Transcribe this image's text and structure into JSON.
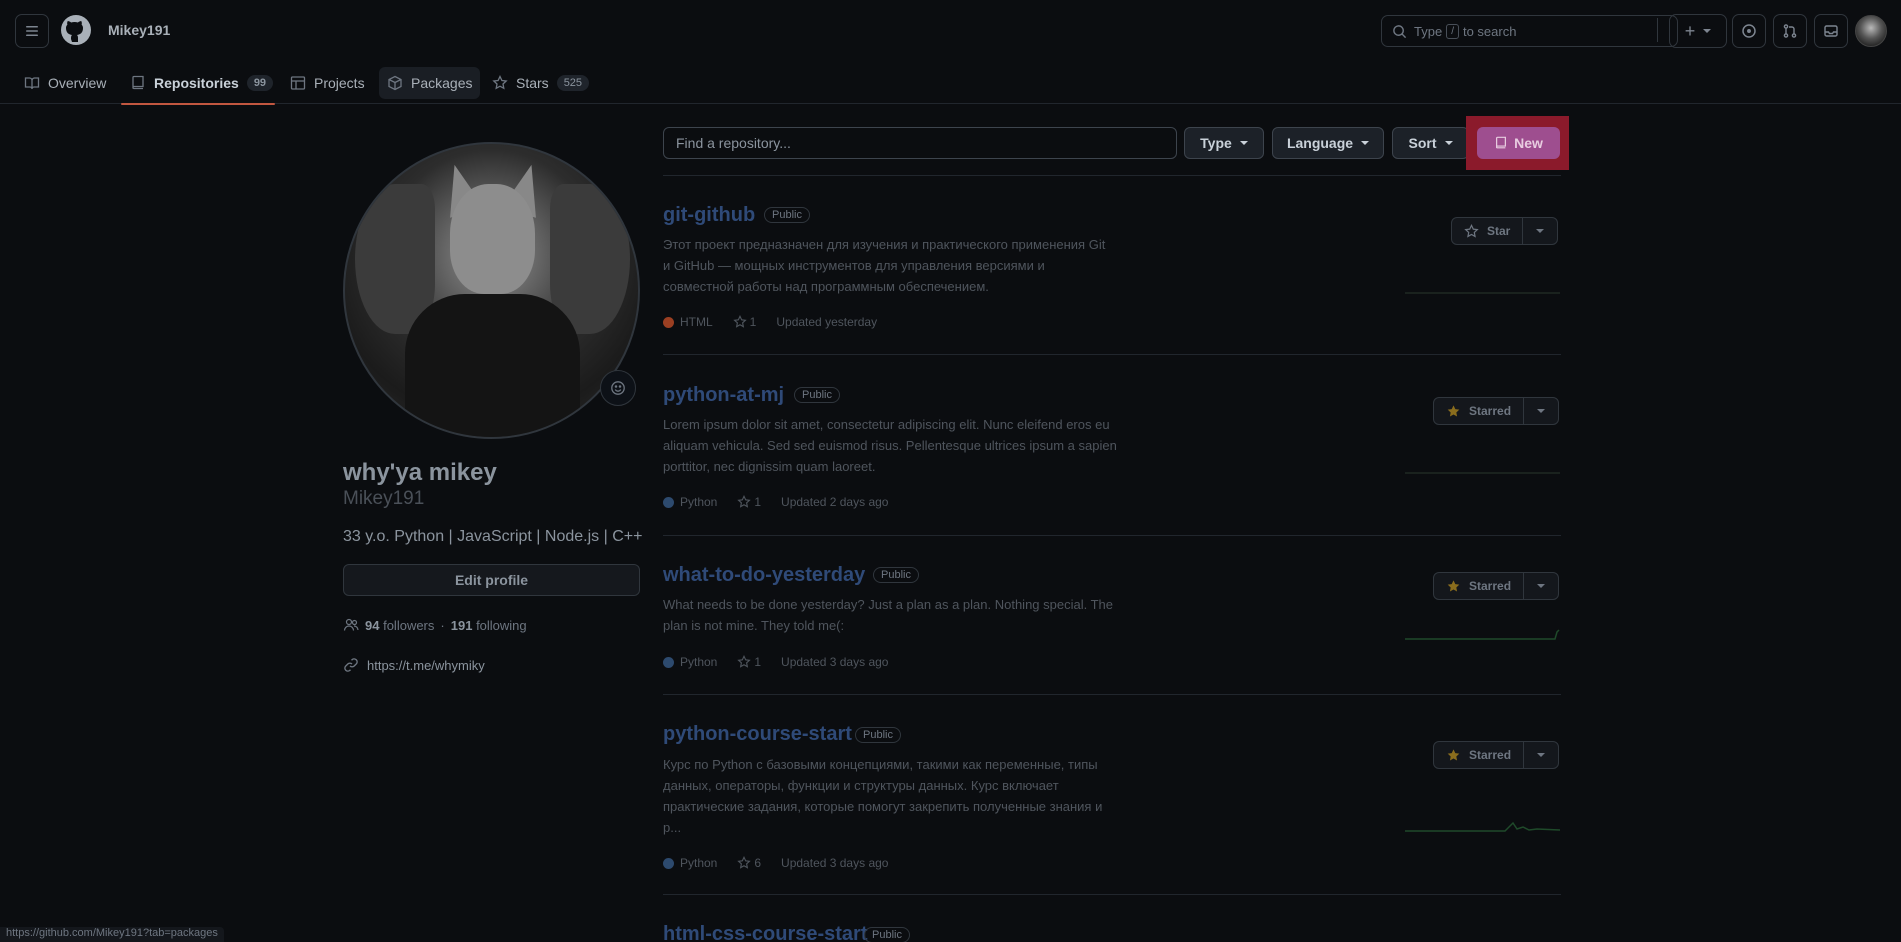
{
  "header": {
    "username": "Mikey191",
    "search_placeholder_before": "Type",
    "search_key": "/",
    "search_placeholder_after": "to search",
    "plus_label": "+"
  },
  "tabs": [
    {
      "label": "Overview",
      "icon": "book-icon"
    },
    {
      "label": "Repositories",
      "count": "99",
      "icon": "repo-icon"
    },
    {
      "label": "Projects",
      "icon": "table-icon"
    },
    {
      "label": "Packages",
      "icon": "package-icon"
    },
    {
      "label": "Stars",
      "count": "525",
      "icon": "star-icon"
    }
  ],
  "profile": {
    "full_name": "why'ya mikey",
    "login": "Mikey191",
    "bio": "33 y.o. Python | JavaScript | Node.js | C++",
    "edit_label": "Edit profile",
    "followers": "94",
    "followers_label": "followers",
    "separator": "·",
    "following": "191",
    "following_label": "following",
    "link": "https://t.me/whymiky"
  },
  "toolbar": {
    "find_placeholder": "Find a repository...",
    "type_label": "Type",
    "language_label": "Language",
    "sort_label": "Sort",
    "new_label": "New"
  },
  "repos": [
    {
      "name": "git-github",
      "visibility": "Public",
      "description_lines": [
        "Этот проект предназначен для изучения и практического применения Git",
        "и GitHub — мощных инструментов для управления версиями и",
        "совместной работы над программным обеспечением."
      ],
      "language": "HTML",
      "language_color": "#9b3f22",
      "stars": "1",
      "updated": "Updated yesterday",
      "star_label": "Star",
      "starred": false
    },
    {
      "name": "python-at-mj",
      "visibility": "Public",
      "description_lines": [
        "Lorem ipsum dolor sit amet, consectetur adipiscing elit. Nunc eleifend eros eu",
        "aliquam vehicula. Sed sed euismod risus. Pellentesque ultrices ipsum a sapien",
        "porttitor, nec dignissim quam laoreet."
      ],
      "language": "Python",
      "language_color": "#2d4a6e",
      "stars": "1",
      "updated": "Updated 2 days ago",
      "star_label": "Starred",
      "starred": true
    },
    {
      "name": "what-to-do-yesterday",
      "visibility": "Public",
      "description_lines": [
        "What needs to be done yesterday? Just a plan as a plan. Nothing special. The",
        "plan is not mine. They told me(:"
      ],
      "language": "Python",
      "language_color": "#2d4a6e",
      "stars": "1",
      "updated": "Updated 3 days ago",
      "star_label": "Starred",
      "starred": true
    },
    {
      "name": "python-course-start",
      "visibility": "Public",
      "description_lines": [
        "Курс по Python с базовыми концепциями, такими как переменные, типы",
        "данных, операторы, функции и структуры данных. Курс включает",
        "практические задания, которые помогут закрепить полученные знания и",
        "р..."
      ],
      "language": "Python",
      "language_color": "#2d4a6e",
      "stars": "6",
      "updated": "Updated 3 days ago",
      "star_label": "Starred",
      "starred": true
    },
    {
      "name": "html-css-course-start",
      "visibility": "Public"
    }
  ],
  "status_url": "https://github.com/Mikey191?tab=packages",
  "colors": {
    "accent_new": "#9e4e8f",
    "highlight_box": "#8b1a2b",
    "starred": "#8a6d1d",
    "tab_underline": "#c25740"
  }
}
